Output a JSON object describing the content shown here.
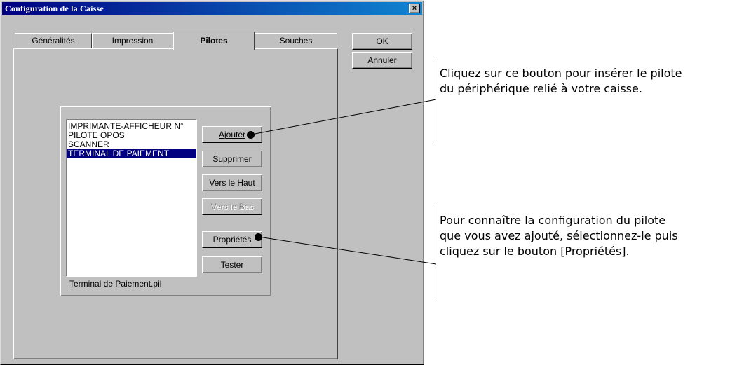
{
  "window": {
    "title": "Configuration de la Caisse",
    "close_glyph": "×"
  },
  "tabs": [
    {
      "label": "Généralités",
      "active": false
    },
    {
      "label": "Impression",
      "active": false
    },
    {
      "label": "Pilotes",
      "active": true
    },
    {
      "label": "Souches",
      "active": false
    }
  ],
  "dialog_buttons": {
    "ok": "OK",
    "cancel": "Annuler"
  },
  "drivers": {
    "items": [
      "IMPRIMANTE-AFFICHEUR N°",
      "PILOTE OPOS",
      "SCANNER",
      "TERMINAL DE PAIEMENT"
    ],
    "selected_index": 3,
    "file_label": "Terminal de Paiement.pil"
  },
  "driver_buttons": {
    "add": "Ajouter",
    "remove": "Supprimer",
    "move_up": "Vers le Haut",
    "move_down": "Vers le Bas",
    "properties": "Propriétés",
    "test": "Tester"
  },
  "annotations": {
    "add_callout": [
      "Cliquez sur ce bouton pour insérer le pilote",
      "du périphérique relié à votre caisse."
    ],
    "properties_callout": [
      "Pour connaître la configuration du pilote",
      "que vous avez ajouté, sélectionnez-le puis",
      "cliquez sur le bouton [Propriétés]."
    ]
  },
  "colors": {
    "title_bar": "#000080",
    "selection": "#000080",
    "face": "#c0c0c0"
  }
}
